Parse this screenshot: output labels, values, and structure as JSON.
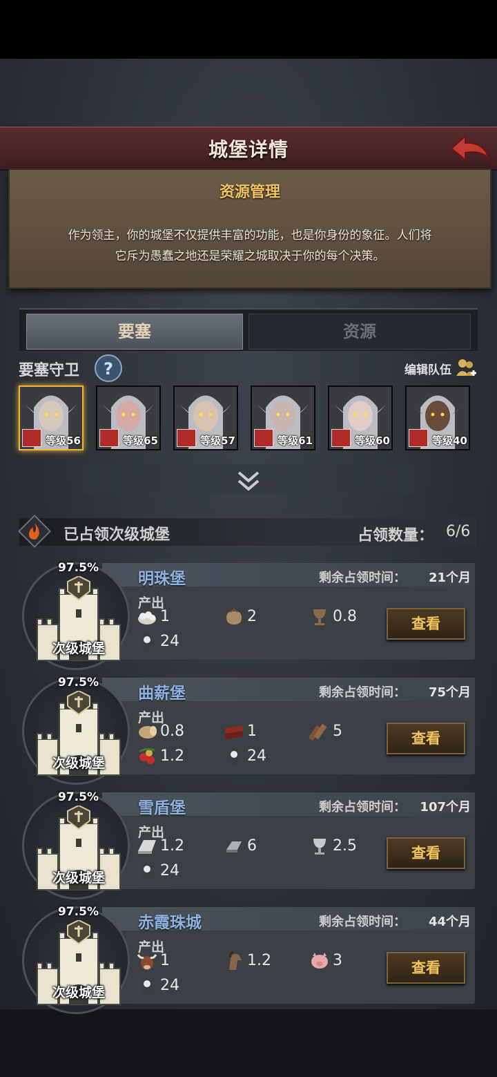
{
  "header": {
    "title": "城堡详情"
  },
  "intro": {
    "title": "资源管理",
    "text_line1": "作为领主，你的城堡不仅提供丰富的功能，也是你身份的象征。人们将",
    "text_line2": "它斥为愚蠢之地还是荣耀之城取决于你的每个决策。"
  },
  "tabs": {
    "fortress": "要塞",
    "resources": "资源",
    "active": "fortress"
  },
  "guards": {
    "label": "要塞守卫",
    "help": "?",
    "edit": "编辑队伍",
    "heroes": [
      {
        "level": "等级56",
        "selected": true
      },
      {
        "level": "等级65"
      },
      {
        "level": "等级57"
      },
      {
        "level": "等级61"
      },
      {
        "level": "等级60"
      },
      {
        "level": "等级40"
      }
    ]
  },
  "section": {
    "title": "已占领次级城堡",
    "count_label": "占领数量：",
    "count": "6/6"
  },
  "castles": [
    {
      "name": "明珠堡",
      "time_label": "剩余占领时间：",
      "time": "21个月",
      "percent": "97.5%",
      "type": "次级城堡",
      "prod_label": "产出",
      "resources": [
        {
          "icon": "cotton-icon",
          "value": "1"
        },
        {
          "icon": "sack-icon",
          "value": "2"
        },
        {
          "icon": "goblet-icon",
          "value": "0.8"
        },
        {
          "icon": "banner-icon",
          "value": "24"
        }
      ],
      "button": "查看"
    },
    {
      "name": "曲薪堡",
      "time_label": "剩余占领时间：",
      "time": "75个月",
      "percent": "97.5%",
      "type": "次级城堡",
      "prod_label": "产出",
      "resources": [
        {
          "icon": "log-icon",
          "value": "0.8"
        },
        {
          "icon": "timber-icon",
          "value": "1"
        },
        {
          "icon": "planks-icon",
          "value": "5"
        },
        {
          "icon": "berries-icon",
          "value": "1.2"
        },
        {
          "icon": "banner-icon",
          "value": "24"
        }
      ],
      "button": "查看"
    },
    {
      "name": "雪盾堡",
      "time_label": "剩余占领时间：",
      "time": "107个月",
      "percent": "97.5%",
      "type": "次级城堡",
      "prod_label": "产出",
      "resources": [
        {
          "icon": "silver-ingot-icon",
          "value": "1.2"
        },
        {
          "icon": "iron-ingot-icon",
          "value": "6"
        },
        {
          "icon": "silver-cup-icon",
          "value": "2.5"
        },
        {
          "icon": "banner-icon",
          "value": "24"
        }
      ],
      "button": "查看"
    },
    {
      "name": "赤霞珠城",
      "time_label": "剩余占领时间：",
      "time": "44个月",
      "percent": "97.5%",
      "type": "次级城堡",
      "prod_label": "产出",
      "resources": [
        {
          "icon": "bull-icon",
          "value": "1"
        },
        {
          "icon": "horse-icon",
          "value": "1.2"
        },
        {
          "icon": "pig-icon",
          "value": "3"
        },
        {
          "icon": "banner-icon",
          "value": "24"
        }
      ],
      "button": "查看"
    }
  ]
}
